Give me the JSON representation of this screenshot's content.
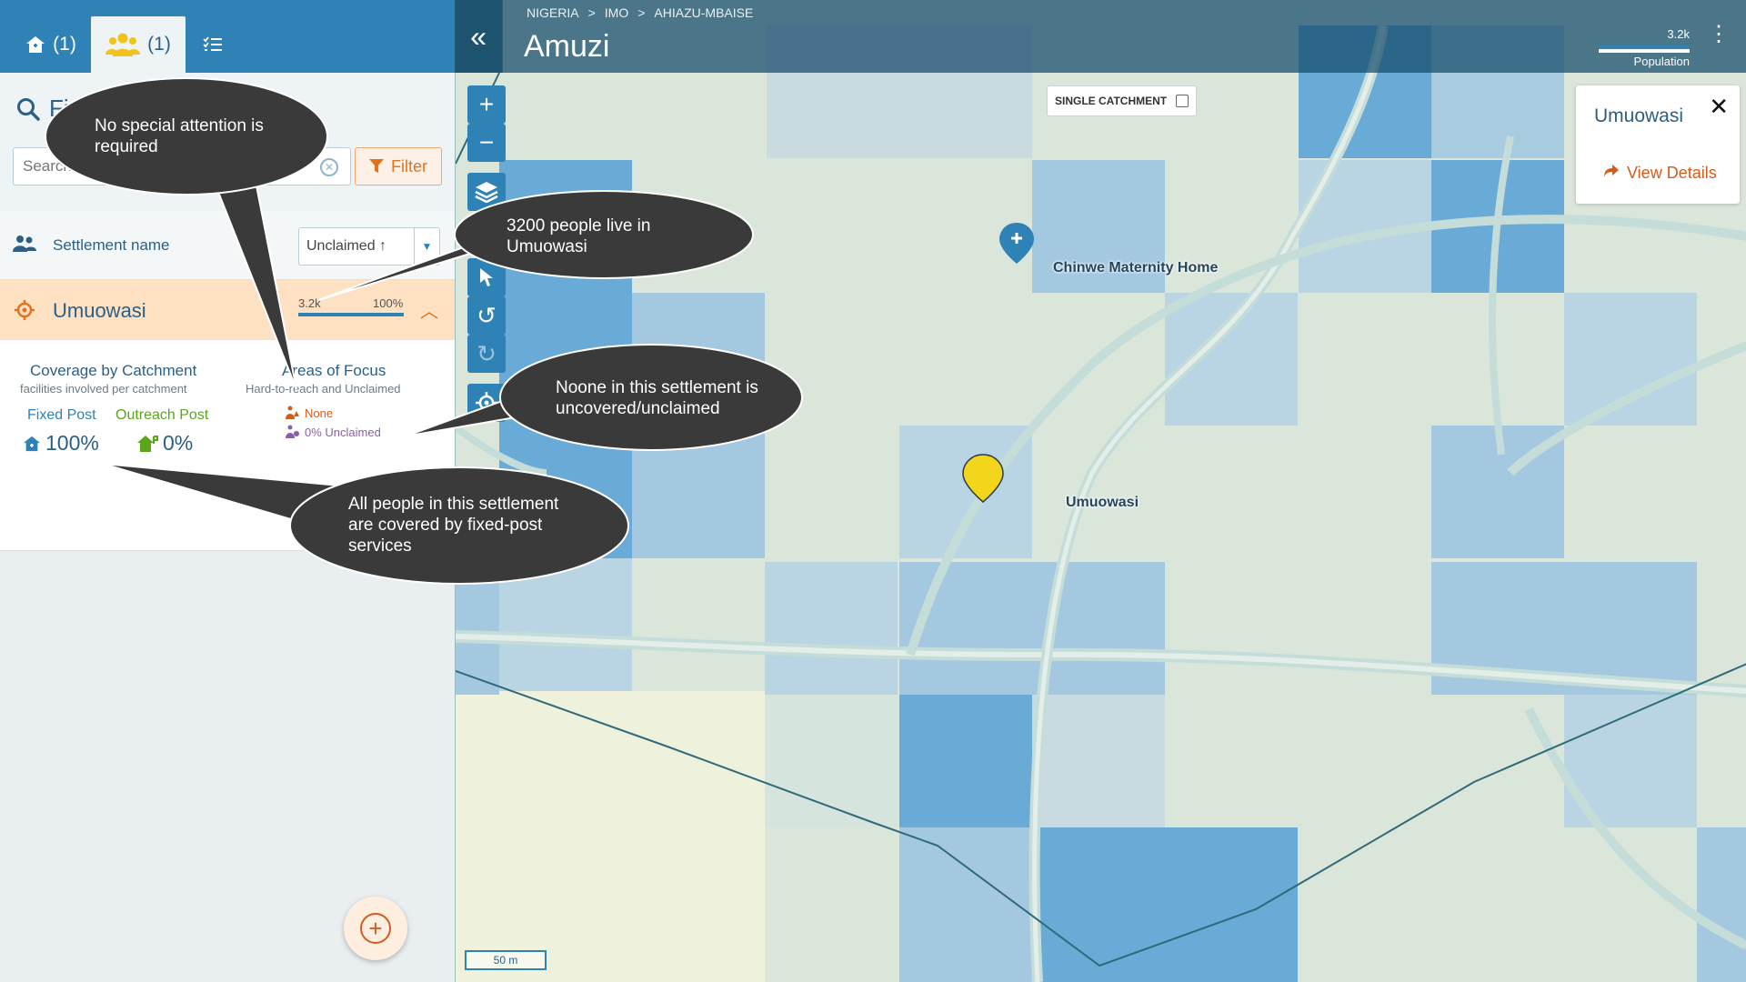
{
  "tabs": {
    "home_count": "(1)",
    "settlements_count": "(1)"
  },
  "find": {
    "title": "Fi",
    "search_placeholder": "Search",
    "filter_label": "Filter"
  },
  "sort": {
    "label": "Settlement name",
    "value": "Unclaimed ↑"
  },
  "settlement": {
    "name": "Umuowasi",
    "population": "3.2k",
    "population_pct": "100%",
    "population_fraction": 1.0
  },
  "details": {
    "coverage_title": "Coverage by Catchment",
    "coverage_sub": "facilities involved per catchment",
    "fixed_label": "Fixed Post",
    "outreach_label": "Outreach Post",
    "fixed_pct": "100%",
    "outreach_pct": "0%",
    "focus_title": "Areas of Focus",
    "focus_sub": "Hard-to-reach and Unclaimed",
    "focus_hard": "None",
    "focus_unclaimed": "0% Unclaimed"
  },
  "header": {
    "breadcrumb": [
      "NIGERIA",
      ">",
      "IMO",
      ">",
      "AHIAZU-MBAISE"
    ],
    "title": "Amuzi",
    "legend_value": "3.2k",
    "legend_label": "Population"
  },
  "map": {
    "single_catchment_label": "SINGLE CATCHMENT",
    "single_catchment_checked": false,
    "facility_label": "Chinwe Maternity Home",
    "settlement_label": "Umuowasi",
    "scale_label": "50 m",
    "info_title": "Umuowasi",
    "info_link": "View Details"
  },
  "callouts": {
    "attention": "No special attention is required",
    "population": "3200 people live in Umuowasi",
    "unclaimed": "Noone in this settlement is uncovered/unclaimed",
    "covered": "All people in this settlement are covered by fixed-post services"
  },
  "colors": {
    "accent": "#2e82b5",
    "orange": "#e2731c",
    "highlight": "#fde1c2",
    "callout": "#3a3a3a",
    "fixed_green": "#5aa51b",
    "unclaimed_purple": "#8b5fa8",
    "hard_orange": "#d35b1c"
  },
  "icons": [
    "home-icon",
    "people-icon",
    "checklist-icon",
    "search-icon",
    "filter-icon",
    "target-icon",
    "plus-icon",
    "minus-icon",
    "layers-icon",
    "pointer-icon",
    "undo-icon",
    "redo-icon",
    "locate-icon",
    "close-icon",
    "share-icon",
    "map-pin-icon",
    "kebab-icon"
  ]
}
